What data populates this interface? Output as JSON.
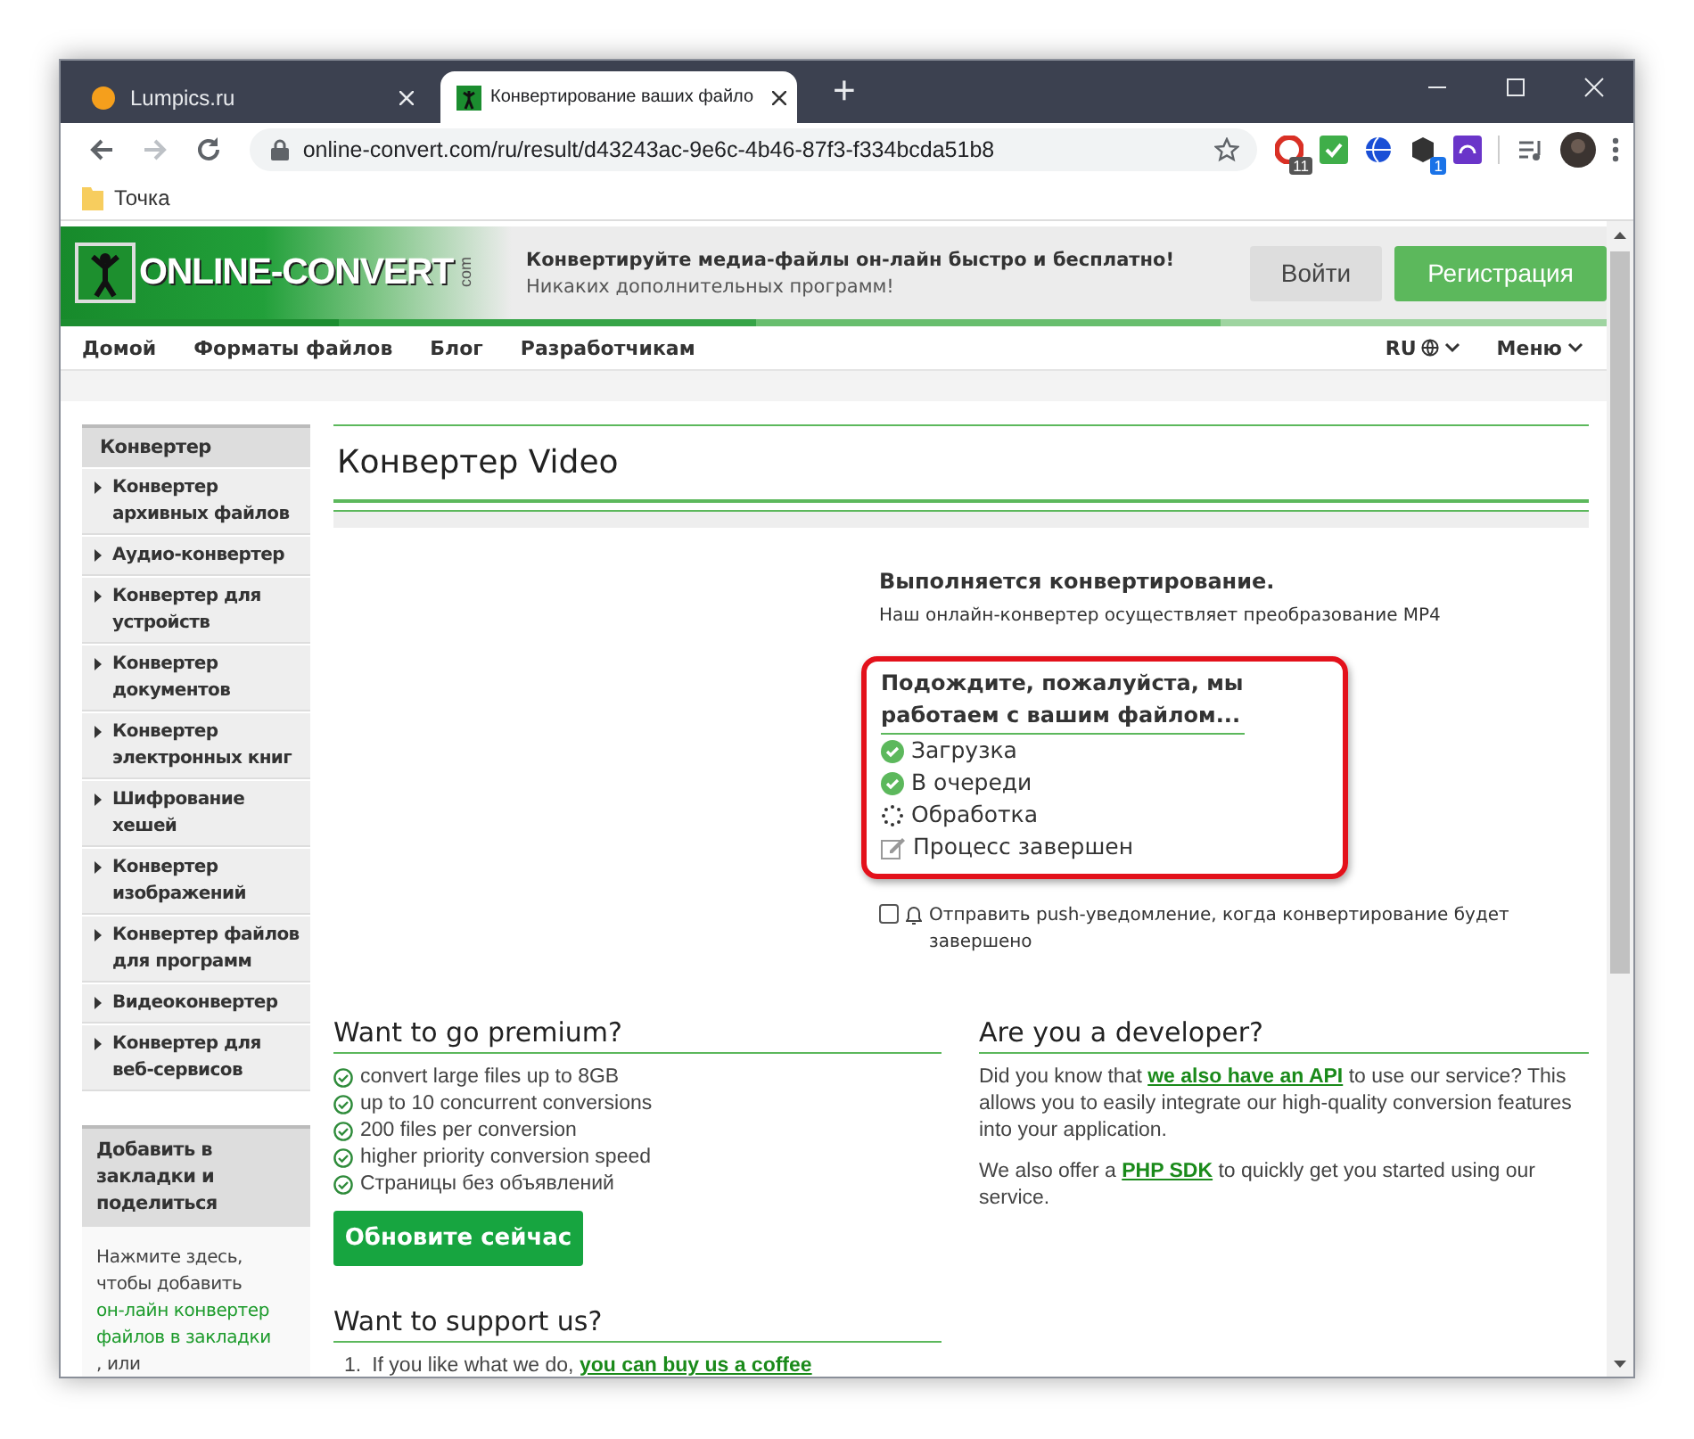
{
  "browser": {
    "tabs": [
      {
        "title": "Lumpics.ru",
        "selected": false
      },
      {
        "title": "Конвертирование ваших файло",
        "selected": true
      }
    ],
    "new_tab": "+",
    "address": "online-convert.com/ru/result/d43243ac-9e6c-4b46-87f3-f334bcda51b8",
    "extension_badges": [
      "11",
      "1"
    ],
    "bookmarks": [
      "Точка"
    ]
  },
  "site_header": {
    "logo": "ONLINE-CONVERT",
    "logo_suffix": "com",
    "tagline": "Конвертируйте медиа-файлы он-лайн быстро и бесплатно!",
    "subtagline": "Никаких дополнительных программ!",
    "login": "Войти",
    "register": "Регистрация"
  },
  "nav": {
    "items": [
      "Домой",
      "Форматы файлов",
      "Блог",
      "Разработчикам"
    ],
    "language": "RU",
    "menu": "Меню"
  },
  "sidebar": {
    "title": "Конвертер",
    "items": [
      "Конвертер архивных файлов",
      "Аудио-конвертер",
      "Конвертер для устройств",
      "Конвертер документов",
      "Конвертер электронных книг",
      "Шифрование хешей",
      "Конвертер изображений",
      "Конвертер файлов для программ",
      "Видеоконвертер",
      "Конвертер для веб-сервисов"
    ],
    "share": {
      "title": "Добавить в закладки и поделиться",
      "before": "Нажмите здесь, чтобы добавить ",
      "link": "он-лайн конвертер файлов в закладки",
      "after": ", или"
    }
  },
  "main": {
    "title": "Конвертер Video",
    "heading": "Выполняется конвертирование.",
    "description": "Наш онлайн-конвертер осуществляет преобразование MP4",
    "wait_heading": "Подождите, пожалуйста, мы работаем с вашим файлом...",
    "steps": [
      {
        "label": "Загрузка",
        "kind": "done"
      },
      {
        "label": "В очереди",
        "kind": "done"
      },
      {
        "label": "Обработка",
        "kind": "processing"
      },
      {
        "label": "Процесс завершен",
        "kind": "pending"
      }
    ],
    "notify": {
      "label": "Отправить push-уведомление, когда конвертирование будет завершено",
      "checked": false
    }
  },
  "premium": {
    "title": "Want to go premium?",
    "features": [
      "convert large files up to 8GB",
      "up to 10 concurrent conversions",
      "200 files per conversion",
      "higher priority conversion speed",
      "Страницы без объявлений"
    ],
    "button": "Обновите сейчас"
  },
  "developer": {
    "title": "Are you a developer?",
    "paragraphs": [
      {
        "before": "Did you know that ",
        "link": "we also have an API",
        "after": " to use our service? This allows you to easily integrate our high-quality conversion features into your application."
      },
      {
        "before": "We also offer a ",
        "link": "PHP SDK",
        "after": " to quickly get you started using our service."
      }
    ]
  },
  "support": {
    "title": "Want to support us?",
    "items": [
      {
        "number": "1.",
        "before": "If you like what we do, ",
        "link": "you can buy us a coffee"
      }
    ]
  }
}
